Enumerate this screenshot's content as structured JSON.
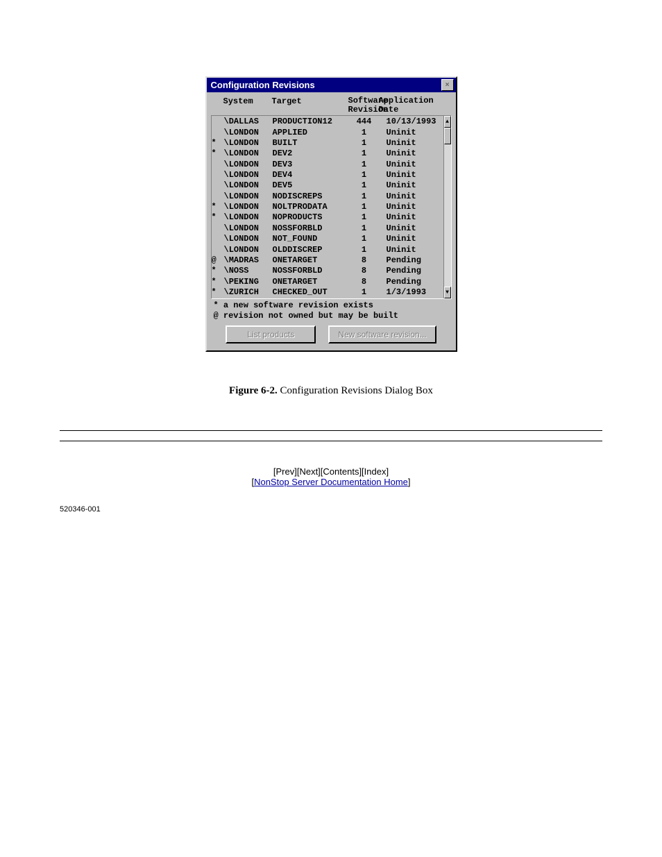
{
  "dialog": {
    "title": "Configuration Revisions",
    "close_glyph": "×",
    "headers": {
      "system": "System",
      "target": "Target",
      "software": "Software",
      "revision": "Revision",
      "application": "Application",
      "date": "Date"
    },
    "rows": [
      {
        "flag": "",
        "system": "\\DALLAS",
        "target": "PRODUCTION12",
        "rev": "444",
        "date": "10/13/1993"
      },
      {
        "flag": "",
        "system": "\\LONDON",
        "target": "APPLIED",
        "rev": "1",
        "date": "Uninit"
      },
      {
        "flag": "*",
        "system": "\\LONDON",
        "target": "BUILT",
        "rev": "1",
        "date": "Uninit"
      },
      {
        "flag": "*",
        "system": "\\LONDON",
        "target": "DEV2",
        "rev": "1",
        "date": "Uninit"
      },
      {
        "flag": "",
        "system": "\\LONDON",
        "target": "DEV3",
        "rev": "1",
        "date": "Uninit"
      },
      {
        "flag": "",
        "system": "\\LONDON",
        "target": "DEV4",
        "rev": "1",
        "date": "Uninit"
      },
      {
        "flag": "",
        "system": "\\LONDON",
        "target": "DEV5",
        "rev": "1",
        "date": "Uninit"
      },
      {
        "flag": "",
        "system": "\\LONDON",
        "target": "NODISCREPS",
        "rev": "1",
        "date": "Uninit"
      },
      {
        "flag": "*",
        "system": "\\LONDON",
        "target": "NOLTPRODATA",
        "rev": "1",
        "date": "Uninit"
      },
      {
        "flag": "*",
        "system": "\\LONDON",
        "target": "NOPRODUCTS",
        "rev": "1",
        "date": "Uninit"
      },
      {
        "flag": "",
        "system": "\\LONDON",
        "target": "NOSSFORBLD",
        "rev": "1",
        "date": "Uninit"
      },
      {
        "flag": "",
        "system": "\\LONDON",
        "target": "NOT_FOUND",
        "rev": "1",
        "date": "Uninit"
      },
      {
        "flag": "",
        "system": "\\LONDON",
        "target": "OLDDISCREP",
        "rev": "1",
        "date": "Uninit"
      },
      {
        "flag": "@",
        "system": "\\MADRAS",
        "target": "ONETARGET",
        "rev": "8",
        "date": "Pending"
      },
      {
        "flag": "*",
        "system": "\\NOSS",
        "target": "NOSSFORBLD",
        "rev": "8",
        "date": "Pending"
      },
      {
        "flag": "*",
        "system": "\\PEKING",
        "target": "ONETARGET",
        "rev": "8",
        "date": "Pending"
      },
      {
        "flag": "*",
        "system": "\\ZURICH",
        "target": "CHECKED_OUT",
        "rev": "1",
        "date": "1/3/1993"
      }
    ],
    "legend1": "* a new software revision exists",
    "legend2": "@ revision not owned but may be built",
    "btn_list": "List products",
    "btn_new": "New software revision...",
    "scroll": {
      "up": "▲",
      "down": "▼"
    }
  },
  "caption": {
    "label": "Figure 6-2.",
    "title": " Configuration Revisions Dialog Box"
  },
  "footer": {
    "nav": "[Prev][Next][Contents][Index]",
    "home_prefix": "[",
    "home_link": "NonStop Server Documentation Home",
    "home_suffix": "]",
    "bottom": "520346-001"
  }
}
